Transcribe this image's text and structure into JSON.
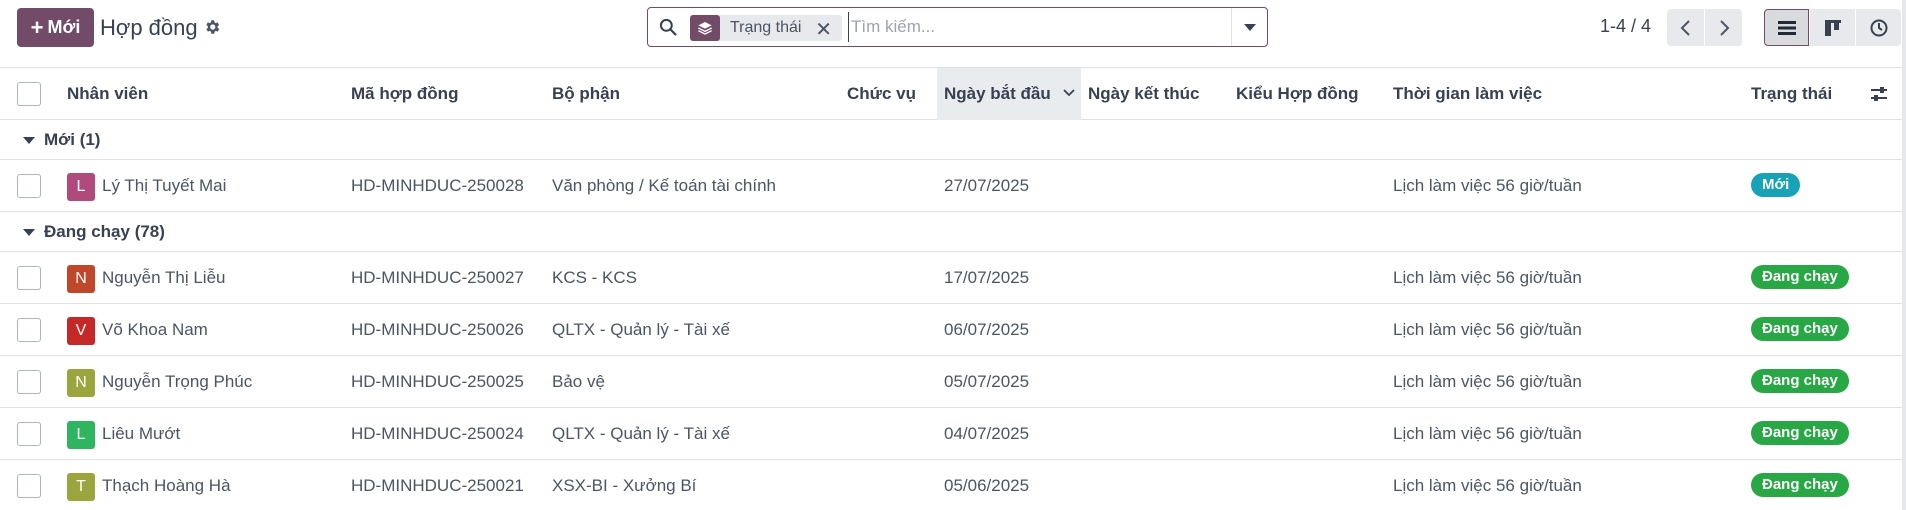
{
  "header": {
    "new_button": "Mới",
    "title": "Hợp đồng",
    "search": {
      "facet_label": "Trạng thái",
      "placeholder": "Tìm kiếm..."
    },
    "pager": "1-4 / 4"
  },
  "columns": {
    "employee": "Nhân viên",
    "contract_code": "Mã hợp đồng",
    "department": "Bộ phận",
    "position": "Chức vụ",
    "start_date": "Ngày bắt đầu",
    "end_date": "Ngày kết thúc",
    "contract_type": "Kiểu Hợp đồng",
    "working_schedule": "Thời gian làm việc",
    "status": "Trạng thái"
  },
  "groups": [
    {
      "label": "Mới (1)",
      "rows": [
        {
          "initial": "L",
          "avatar_color": "#b04a7c",
          "employee": "Lý Thị Tuyết Mai",
          "code": "HD-MINHDUC-250028",
          "department": "Văn phòng / Kế toán tài chính",
          "start": "27/07/2025",
          "schedule": "Lịch làm việc 56 giờ/tuần",
          "status": "Mới",
          "status_color": "#17a2b8"
        }
      ]
    },
    {
      "label": "Đang chạy (78)",
      "rows": [
        {
          "initial": "N",
          "avatar_color": "#c0472a",
          "employee": "Nguyễn Thị Liễu",
          "code": "HD-MINHDUC-250027",
          "department": "KCS - KCS",
          "start": "17/07/2025",
          "schedule": "Lịch làm việc 56 giờ/tuần",
          "status": "Đang chạy",
          "status_color": "#28a745"
        },
        {
          "initial": "V",
          "avatar_color": "#c62828",
          "employee": "Võ Khoa Nam",
          "code": "HD-MINHDUC-250026",
          "department": "QLTX - Quản lý - Tài xế",
          "start": "06/07/2025",
          "schedule": "Lịch làm việc 56 giờ/tuần",
          "status": "Đang chạy",
          "status_color": "#28a745"
        },
        {
          "initial": "N",
          "avatar_color": "#9aa63d",
          "employee": "Nguyễn Trọng Phúc",
          "code": "HD-MINHDUC-250025",
          "department": "Bảo vệ",
          "start": "05/07/2025",
          "schedule": "Lịch làm việc 56 giờ/tuần",
          "status": "Đang chạy",
          "status_color": "#28a745"
        },
        {
          "initial": "L",
          "avatar_color": "#2fb560",
          "employee": "Liêu Mướt",
          "code": "HD-MINHDUC-250024",
          "department": "QLTX - Quản lý - Tài xế",
          "start": "04/07/2025",
          "schedule": "Lịch làm việc 56 giờ/tuần",
          "status": "Đang chạy",
          "status_color": "#28a745"
        },
        {
          "initial": "T",
          "avatar_color": "#9aa63d",
          "employee": "Thạch Hoàng Hà",
          "code": "HD-MINHDUC-250021",
          "department": "XSX-BI - Xưởng Bí",
          "start": "05/06/2025",
          "schedule": "Lịch làm việc 56 giờ/tuần",
          "status": "Đang chạy",
          "status_color": "#28a745"
        }
      ]
    }
  ]
}
